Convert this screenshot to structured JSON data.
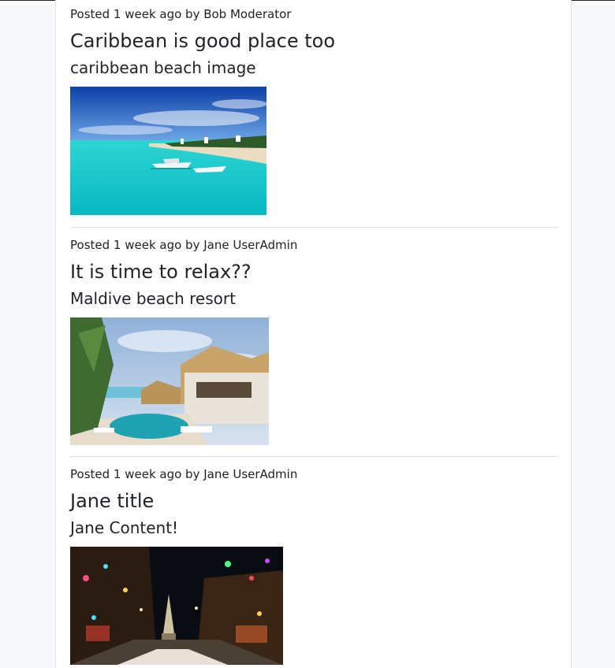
{
  "posts": [
    {
      "meta": "Posted 1 week ago by Bob Moderator",
      "title": "Caribbean is good place too",
      "content": "caribbean beach image",
      "image_subject": "caribbean beach with boats"
    },
    {
      "meta": "Posted 1 week ago by Jane UserAdmin",
      "title": "It is time to relax??",
      "content": "Maldive beach resort",
      "image_subject": "beach resort with pool"
    },
    {
      "meta": "Posted 1 week ago by Jane UserAdmin",
      "title": "Jane title",
      "content": "Jane Content!",
      "image_subject": "night street with holiday lights"
    }
  ],
  "colors": {
    "page_background": "#f7f8fa",
    "card_background": "#ffffff",
    "divider": "#dfe2e6",
    "text": "#212529"
  }
}
